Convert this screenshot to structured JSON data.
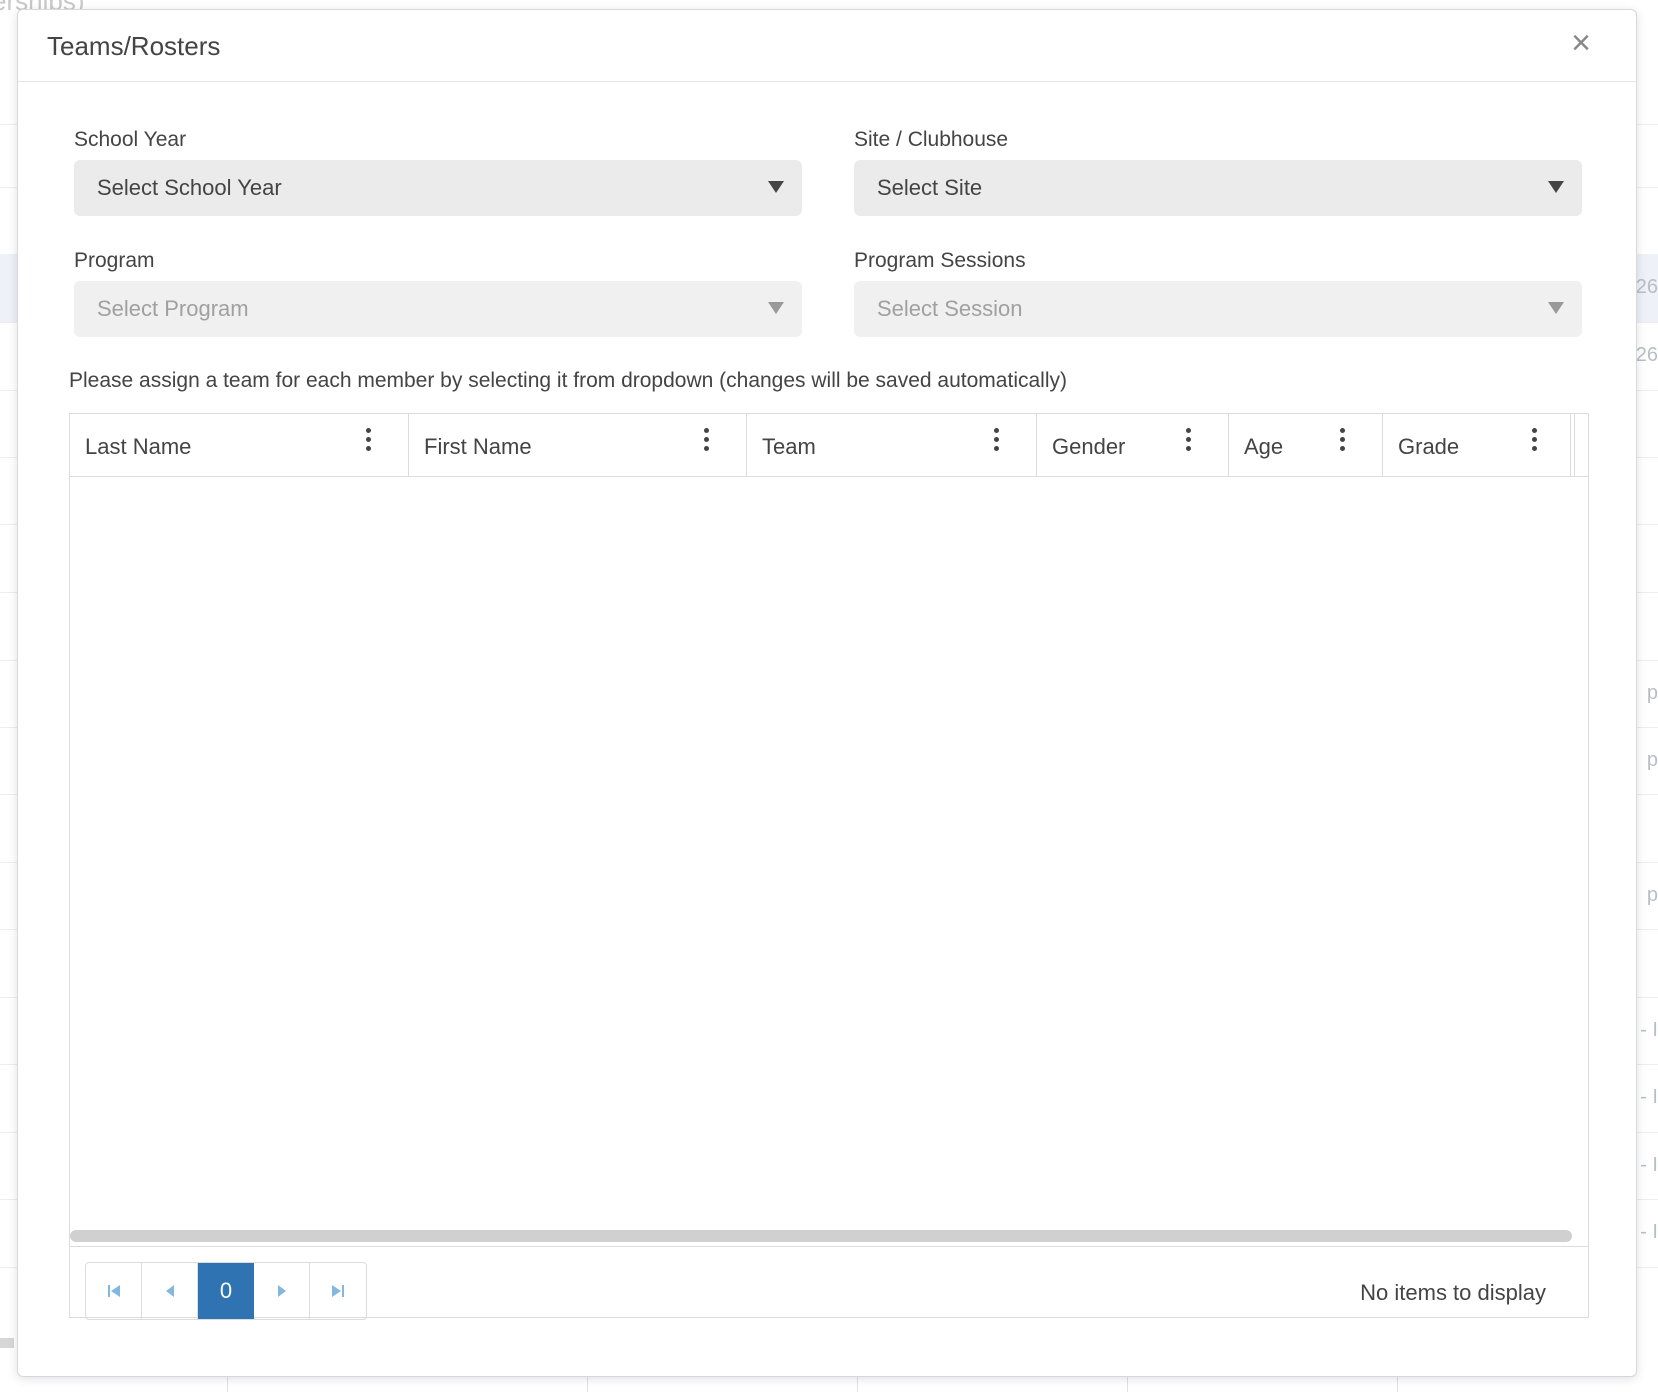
{
  "background": {
    "title_fragment": "erships)",
    "side_texts": [
      "26",
      "26",
      "p",
      "p",
      "p",
      "- I",
      "- I",
      "- I",
      "- I"
    ]
  },
  "modal": {
    "title": "Teams/Rosters",
    "close_glyph": "×",
    "fields": {
      "school_year": {
        "label": "School Year",
        "value": "Select School Year"
      },
      "site": {
        "label": "Site / Clubhouse",
        "value": "Select Site"
      },
      "program": {
        "label": "Program",
        "value": "Select Program"
      },
      "sessions": {
        "label": "Program Sessions",
        "value": "Select Session"
      }
    },
    "instruction": "Please assign a team for each member by selecting it from dropdown (changes will be saved automatically)",
    "grid": {
      "columns": [
        "Last Name",
        "First Name",
        "Team",
        "Gender",
        "Age",
        "Grade"
      ],
      "rows": []
    },
    "pager": {
      "first_icon": "first-page-icon",
      "prev_icon": "previous-page-icon",
      "current_page": "0",
      "next_icon": "next-page-icon",
      "last_icon": "last-page-icon",
      "info": "No items to display"
    }
  }
}
